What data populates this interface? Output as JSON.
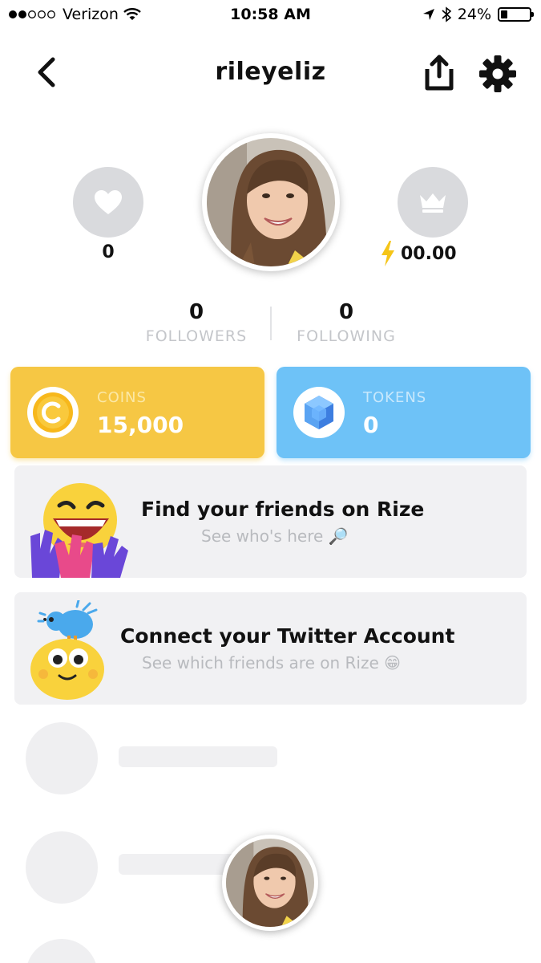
{
  "status_bar": {
    "carrier": "Verizon",
    "time": "10:58 AM",
    "battery": "24%",
    "battery_level": 0.24,
    "signal_icon": "signal-dots-icon",
    "wifi_icon": "wifi-icon",
    "location_icon": "location-arrow-icon",
    "bluetooth_icon": "bluetooth-icon"
  },
  "nav": {
    "title": "rileyeliz",
    "back_icon": "chevron-left-icon",
    "share_icon": "share-icon",
    "settings_icon": "gear-icon"
  },
  "profile": {
    "likes_icon": "heart-icon",
    "likes": "0",
    "rank_icon": "crown-icon",
    "energy_icon": "lightning-icon",
    "energy": "00.00",
    "followers_count": "0",
    "followers_label": "FOLLOWERS",
    "following_count": "0",
    "following_label": "FOLLOWING"
  },
  "wallet": {
    "coins_label": "COINS",
    "coins_value": "15,000",
    "coins_icon": "coin-icon",
    "tokens_label": "TOKENS",
    "tokens_value": "0",
    "tokens_icon": "gem-icon"
  },
  "cards": {
    "friends_title": "Find your friends on Rize",
    "friends_subtitle": "See who's here 🔎",
    "twitter_title": "Connect your Twitter Account",
    "twitter_subtitle": "See which friends are on Rize 😁"
  },
  "colors": {
    "coins": "#f6c744",
    "tokens": "#6ec2f7",
    "energy": "#f5c518",
    "card_bg": "#f1f1f3"
  }
}
